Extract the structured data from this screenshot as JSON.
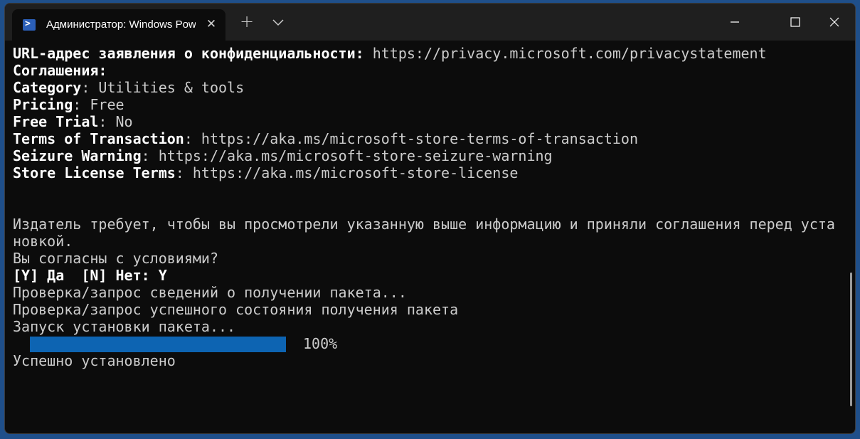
{
  "window": {
    "tab_title": "Администратор: Windows Pow",
    "icons": {
      "tab": "powershell-icon",
      "close_tab": "close-icon",
      "new_tab": "plus-icon",
      "dropdown": "chevron-down-icon",
      "minimize": "minimize-icon",
      "maximize": "maximize-icon",
      "close": "close-icon"
    },
    "colors": {
      "terminal_bg": "#0c0c0c",
      "titlebar_bg": "#1f1f1f",
      "text": "#cccccc",
      "progress": "#0d64b2"
    }
  },
  "terminal": {
    "lines": [
      {
        "key": "URL-адрес заявления о конфиденциальности:",
        "value": " https://privacy.microsoft.com/privacystatement"
      },
      {
        "key": "Соглашения:",
        "value": ""
      },
      {
        "key": "Category",
        "value": ": Utilities & tools"
      },
      {
        "key": "Pricing",
        "value": ": Free"
      },
      {
        "key": "Free Trial",
        "value": ": No"
      },
      {
        "key": "Terms of Transaction",
        "value": ": https://aka.ms/microsoft-store-terms-of-transaction"
      },
      {
        "key": "Seizure Warning",
        "value": ": https://aka.ms/microsoft-store-seizure-warning"
      },
      {
        "key": "Store License Terms",
        "value": ": https://aka.ms/microsoft-store-license"
      }
    ],
    "publisher_notice_1": "Издатель требует, чтобы вы просмотрели указанную выше информацию и приняли соглашения перед уста",
    "publisher_notice_2": "новкой.",
    "agree_question": "Вы согласны с условиями?",
    "agree_prompt": "[Y] Да  [N] Нет: Y",
    "verify_1": "Проверка/запрос сведений о получении пакета...",
    "verify_2": "Проверка/запрос успешного состояния получения пакета",
    "install_start": "Запуск установки пакета...",
    "progress": {
      "percent": 100,
      "label": "100%"
    },
    "success": "Успешно установлено"
  }
}
